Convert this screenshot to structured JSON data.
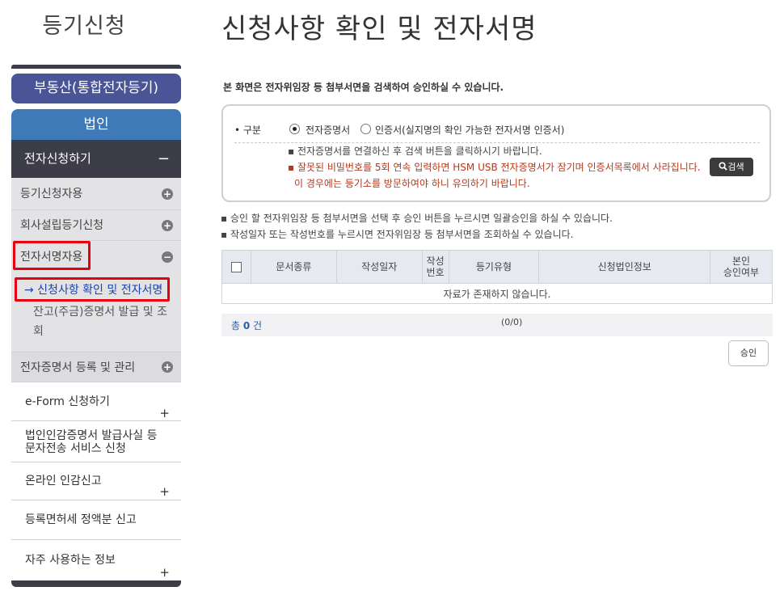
{
  "sidebar": {
    "title": "등기신청",
    "btn_realestate": "부동산(통합전자등기)",
    "btn_corporate": "법인",
    "section_head": "전자신청하기",
    "section_sign": "−",
    "subs": [
      {
        "label": "등기신청자용",
        "sign": "+"
      },
      {
        "label": "회사설립등기신청",
        "sign": "+"
      },
      {
        "label": "전자서명자용",
        "sign": "−"
      },
      {
        "label": "전자증명서 등록 및 관리",
        "sign": "+"
      }
    ],
    "leaf_active": "→ 신청사항 확인 및 전자서명",
    "leaf_other": "잔고(주금)증명서 발급 및 조회",
    "items": [
      {
        "label": "e-Form 신청하기",
        "plus": "+"
      },
      {
        "label": "법인인감증명서 발급사실 등 문자전송 서비스 신청",
        "plus": ""
      },
      {
        "label": "온라인 인감신고",
        "plus": "+"
      },
      {
        "label": "등록면허세 정액분 신고",
        "plus": ""
      },
      {
        "label": "자주 사용하는 정보",
        "plus": "+"
      }
    ]
  },
  "main": {
    "title": "신청사항 확인 및 전자서명",
    "description": "본 화면은 전자위임장 등 첨부서면을 검색하여 승인하실 수 있습니다.",
    "search": {
      "label": "• 구분",
      "option1": "전자증명서",
      "option2": "인증서(실지명의 확인 가능한 전자서명 인증서)",
      "note1": "▪ 전자증명서를 연결하신 후 검색 버튼을 클릭하시기 바랍니다.",
      "note2": "▪ 잘못된 비밀번호를 5회 연속 입력하면 HSM USB 전자증명서가 잠기며 인증서목록에서 사라집니다.",
      "note3": "이 경우에는 등기소를 방문하여야 하니 유의하기 바랍니다.",
      "search_button": "검색"
    },
    "guide1": "▪ 승인 할 전자위임장 등 첨부서면을 선택 후 승인 버튼을 누르시면 일괄승인을 하실 수 있습니다.",
    "guide2": "▪ 작성일자 또는 작성번호를 누르시면 전자위임장 등 첨부서면을 조회하실 수 있습니다.",
    "table": {
      "headers": [
        "문서종류",
        "작성일자",
        "작성\n번호",
        "등기유형",
        "신청법인정보",
        "본인\n승인여부"
      ],
      "empty": "자료가 존재하지 않습니다."
    },
    "total_prefix": "총 ",
    "total_count": "0",
    "total_suffix": " 건",
    "pager": "(0/0)",
    "approve_button": "승인"
  },
  "colors": {
    "sidebar_dark": "#3d3d4a",
    "realestate_btn": "#4a5598",
    "corporate_btn": "#3e7ab8",
    "highlight_red": "#e3000f",
    "warning_text": "#b23a1e",
    "link_blue": "#1a43a8"
  }
}
